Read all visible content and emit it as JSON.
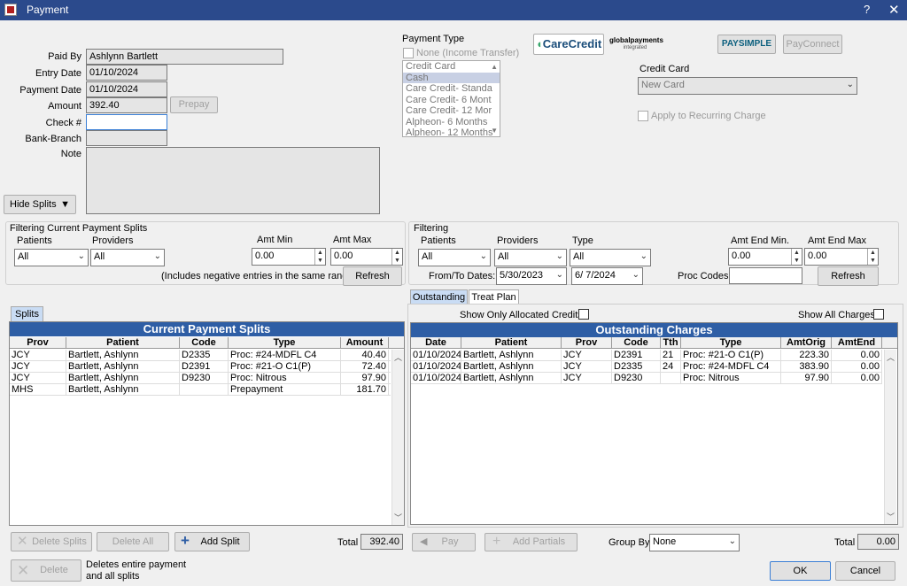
{
  "window": {
    "title": "Payment",
    "help": "?",
    "close": "✕"
  },
  "form": {
    "paid_by_label": "Paid By",
    "paid_by": "Ashlynn Bartlett",
    "entry_date_label": "Entry Date",
    "entry_date": "01/10/2024",
    "payment_date_label": "Payment Date",
    "payment_date": "01/10/2024",
    "amount_label": "Amount",
    "amount": "392.40",
    "prepay": "Prepay",
    "check_label": "Check #",
    "check": "",
    "bank_label": "Bank-Branch",
    "bank": "",
    "note_label": "Note",
    "note": "",
    "hide_splits": "Hide Splits"
  },
  "payment_type": {
    "label": "Payment Type",
    "none_income": "None (Income Transfer)",
    "options": [
      "Credit Card",
      "Cash",
      "Care Credit- Standa",
      "Care Credit- 6 Mont",
      "Care Credit- 12 Mor",
      "Alpheon- 6 Months",
      "Alpheon- 12 Months"
    ],
    "selected": "Cash"
  },
  "logos": {
    "carecredit": "CareCredit",
    "globalpayments": "globalpayments",
    "gp_sub": "integrated",
    "paysimple": "PAYSIMPLE",
    "payconnect": "PayConnect"
  },
  "credit_card": {
    "label": "Credit Card",
    "value": "New Card",
    "recurring": "Apply to Recurring Charge"
  },
  "filter_current": {
    "title": "Filtering Current Payment Splits",
    "patients_label": "Patients",
    "patients": "All",
    "providers_label": "Providers",
    "providers": "All",
    "amt_min_label": "Amt Min",
    "amt_min": "0.00",
    "amt_max_label": "Amt Max",
    "amt_max": "0.00",
    "note": "(Includes negative entries in the same range)",
    "refresh": "Refresh"
  },
  "filter_out": {
    "title": "Filtering",
    "patients_label": "Patients",
    "patients": "All",
    "providers_label": "Providers",
    "providers": "All",
    "type_label": "Type",
    "type": "All",
    "amt_end_min_label": "Amt End Min.",
    "amt_end_min": "0.00",
    "amt_end_max_label": "Amt End Max",
    "amt_end_max": "0.00",
    "dates_label": "From/To Dates:",
    "from": "5/30/2023",
    "to": "6/ 7/2024",
    "proc_codes_label": "Proc Codes:",
    "proc_codes": "",
    "refresh": "Refresh"
  },
  "splits": {
    "tab": "Splits",
    "title": "Current Payment Splits",
    "columns": [
      "Prov",
      "Patient",
      "Code",
      "Type",
      "Amount"
    ],
    "rows": [
      [
        "JCY",
        "Bartlett, Ashlynn",
        "D2335",
        "Proc: #24-MDFL C4",
        "40.40"
      ],
      [
        "JCY",
        "Bartlett, Ashlynn",
        "D2391",
        "Proc: #21-O C1(P)",
        "72.40"
      ],
      [
        "JCY",
        "Bartlett, Ashlynn",
        "D9230",
        "Proc:  Nitrous",
        "97.90"
      ],
      [
        "MHS",
        "Bartlett, Ashlynn",
        "",
        "Prepayment",
        "181.70"
      ]
    ],
    "delete_splits": "Delete Splits",
    "delete_all": "Delete All",
    "add_split": "Add Split",
    "total_label": "Total",
    "total": "392.40"
  },
  "outstanding": {
    "tab1": "Outstanding",
    "tab2": "Treat Plan",
    "show_allocated": "Show Only Allocated Credits",
    "show_all": "Show All Charges",
    "title": "Outstanding Charges",
    "columns": [
      "Date",
      "Patient",
      "Prov",
      "Code",
      "Tth",
      "Type",
      "AmtOrig",
      "AmtEnd"
    ],
    "rows": [
      [
        "01/10/2024",
        "Bartlett, Ashlynn",
        "JCY",
        "D2391",
        "21",
        "Proc: #21-O C1(P)",
        "223.30",
        "0.00"
      ],
      [
        "01/10/2024",
        "Bartlett, Ashlynn",
        "JCY",
        "D2335",
        "24",
        "Proc: #24-MDFL C4",
        "383.90",
        "0.00"
      ],
      [
        "01/10/2024",
        "Bartlett, Ashlynn",
        "JCY",
        "D9230",
        "",
        "Proc:  Nitrous",
        "97.90",
        "0.00"
      ]
    ],
    "pay": "Pay",
    "add_partials": "Add Partials",
    "group_by_label": "Group By",
    "group_by": "None",
    "total_label": "Total",
    "total": "0.00"
  },
  "footer": {
    "delete": "Delete",
    "delete_note_1": "Deletes entire payment",
    "delete_note_2": "and all splits",
    "ok": "OK",
    "cancel": "Cancel"
  }
}
